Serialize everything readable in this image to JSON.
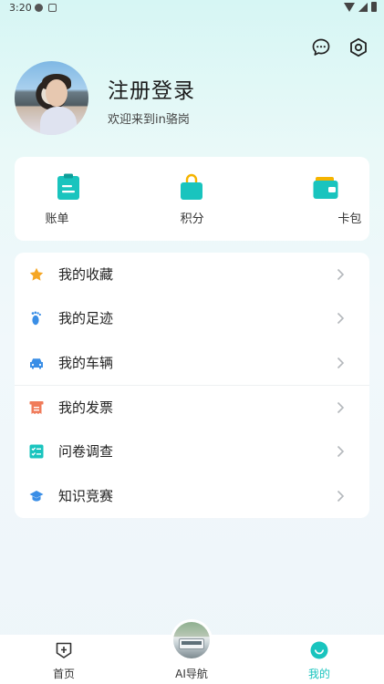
{
  "status_bar": {
    "time": "3:20"
  },
  "header": {
    "title": "注册登录",
    "subtitle": "欢迎来到in骆岗"
  },
  "quick_actions": [
    {
      "label": "账单",
      "icon": "bill-icon"
    },
    {
      "label": "积分",
      "icon": "points-bag-icon"
    },
    {
      "label": "卡包",
      "icon": "wallet-icon"
    }
  ],
  "menu": [
    {
      "label": "我的收藏",
      "icon": "star-icon",
      "color": "#f5a623"
    },
    {
      "label": "我的足迹",
      "icon": "footprint-icon",
      "color": "#3a8ee6"
    },
    {
      "label": "我的车辆",
      "icon": "car-icon",
      "color": "#3a8ee6"
    },
    {
      "label": "我的发票",
      "icon": "invoice-icon",
      "color": "#f07b5a"
    },
    {
      "label": "问卷调查",
      "icon": "checklist-icon",
      "color": "#19c4be"
    },
    {
      "label": "知识竞赛",
      "icon": "graduation-cap-icon",
      "color": "#3a8ee6"
    }
  ],
  "tab_bar": {
    "home": "首页",
    "ai": "AI导航",
    "mine": "我的",
    "active": "mine"
  },
  "colors": {
    "accent": "#19c4be"
  }
}
